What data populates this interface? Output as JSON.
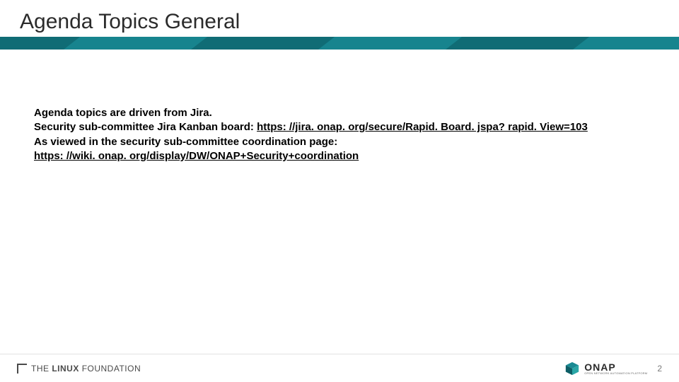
{
  "slide": {
    "title": "Agenda Topics General",
    "body": {
      "line1": "Agenda topics are driven from Jira.",
      "line2_prefix": "Security sub-committee Jira Kanban board: ",
      "line2_link": "https: //jira. onap. org/secure/Rapid. Board. jspa? rapid. View=103",
      "line3": "As viewed in the security sub-committee coordination page:",
      "line4_link": "https: //wiki. onap. org/display/DW/ONAP+Security+coordination"
    }
  },
  "footer": {
    "lf_the": "THE",
    "lf_linux": "LINUX",
    "lf_foundation": "FOUNDATION",
    "onap_name": "ONAP",
    "onap_tagline": "OPEN NETWORK AUTOMATION PLATFORM",
    "page_number": "2"
  },
  "colors": {
    "teal_dark": "#0f6e78",
    "teal_mid": "#1a8a93",
    "teal_light": "#2aa6a6"
  }
}
